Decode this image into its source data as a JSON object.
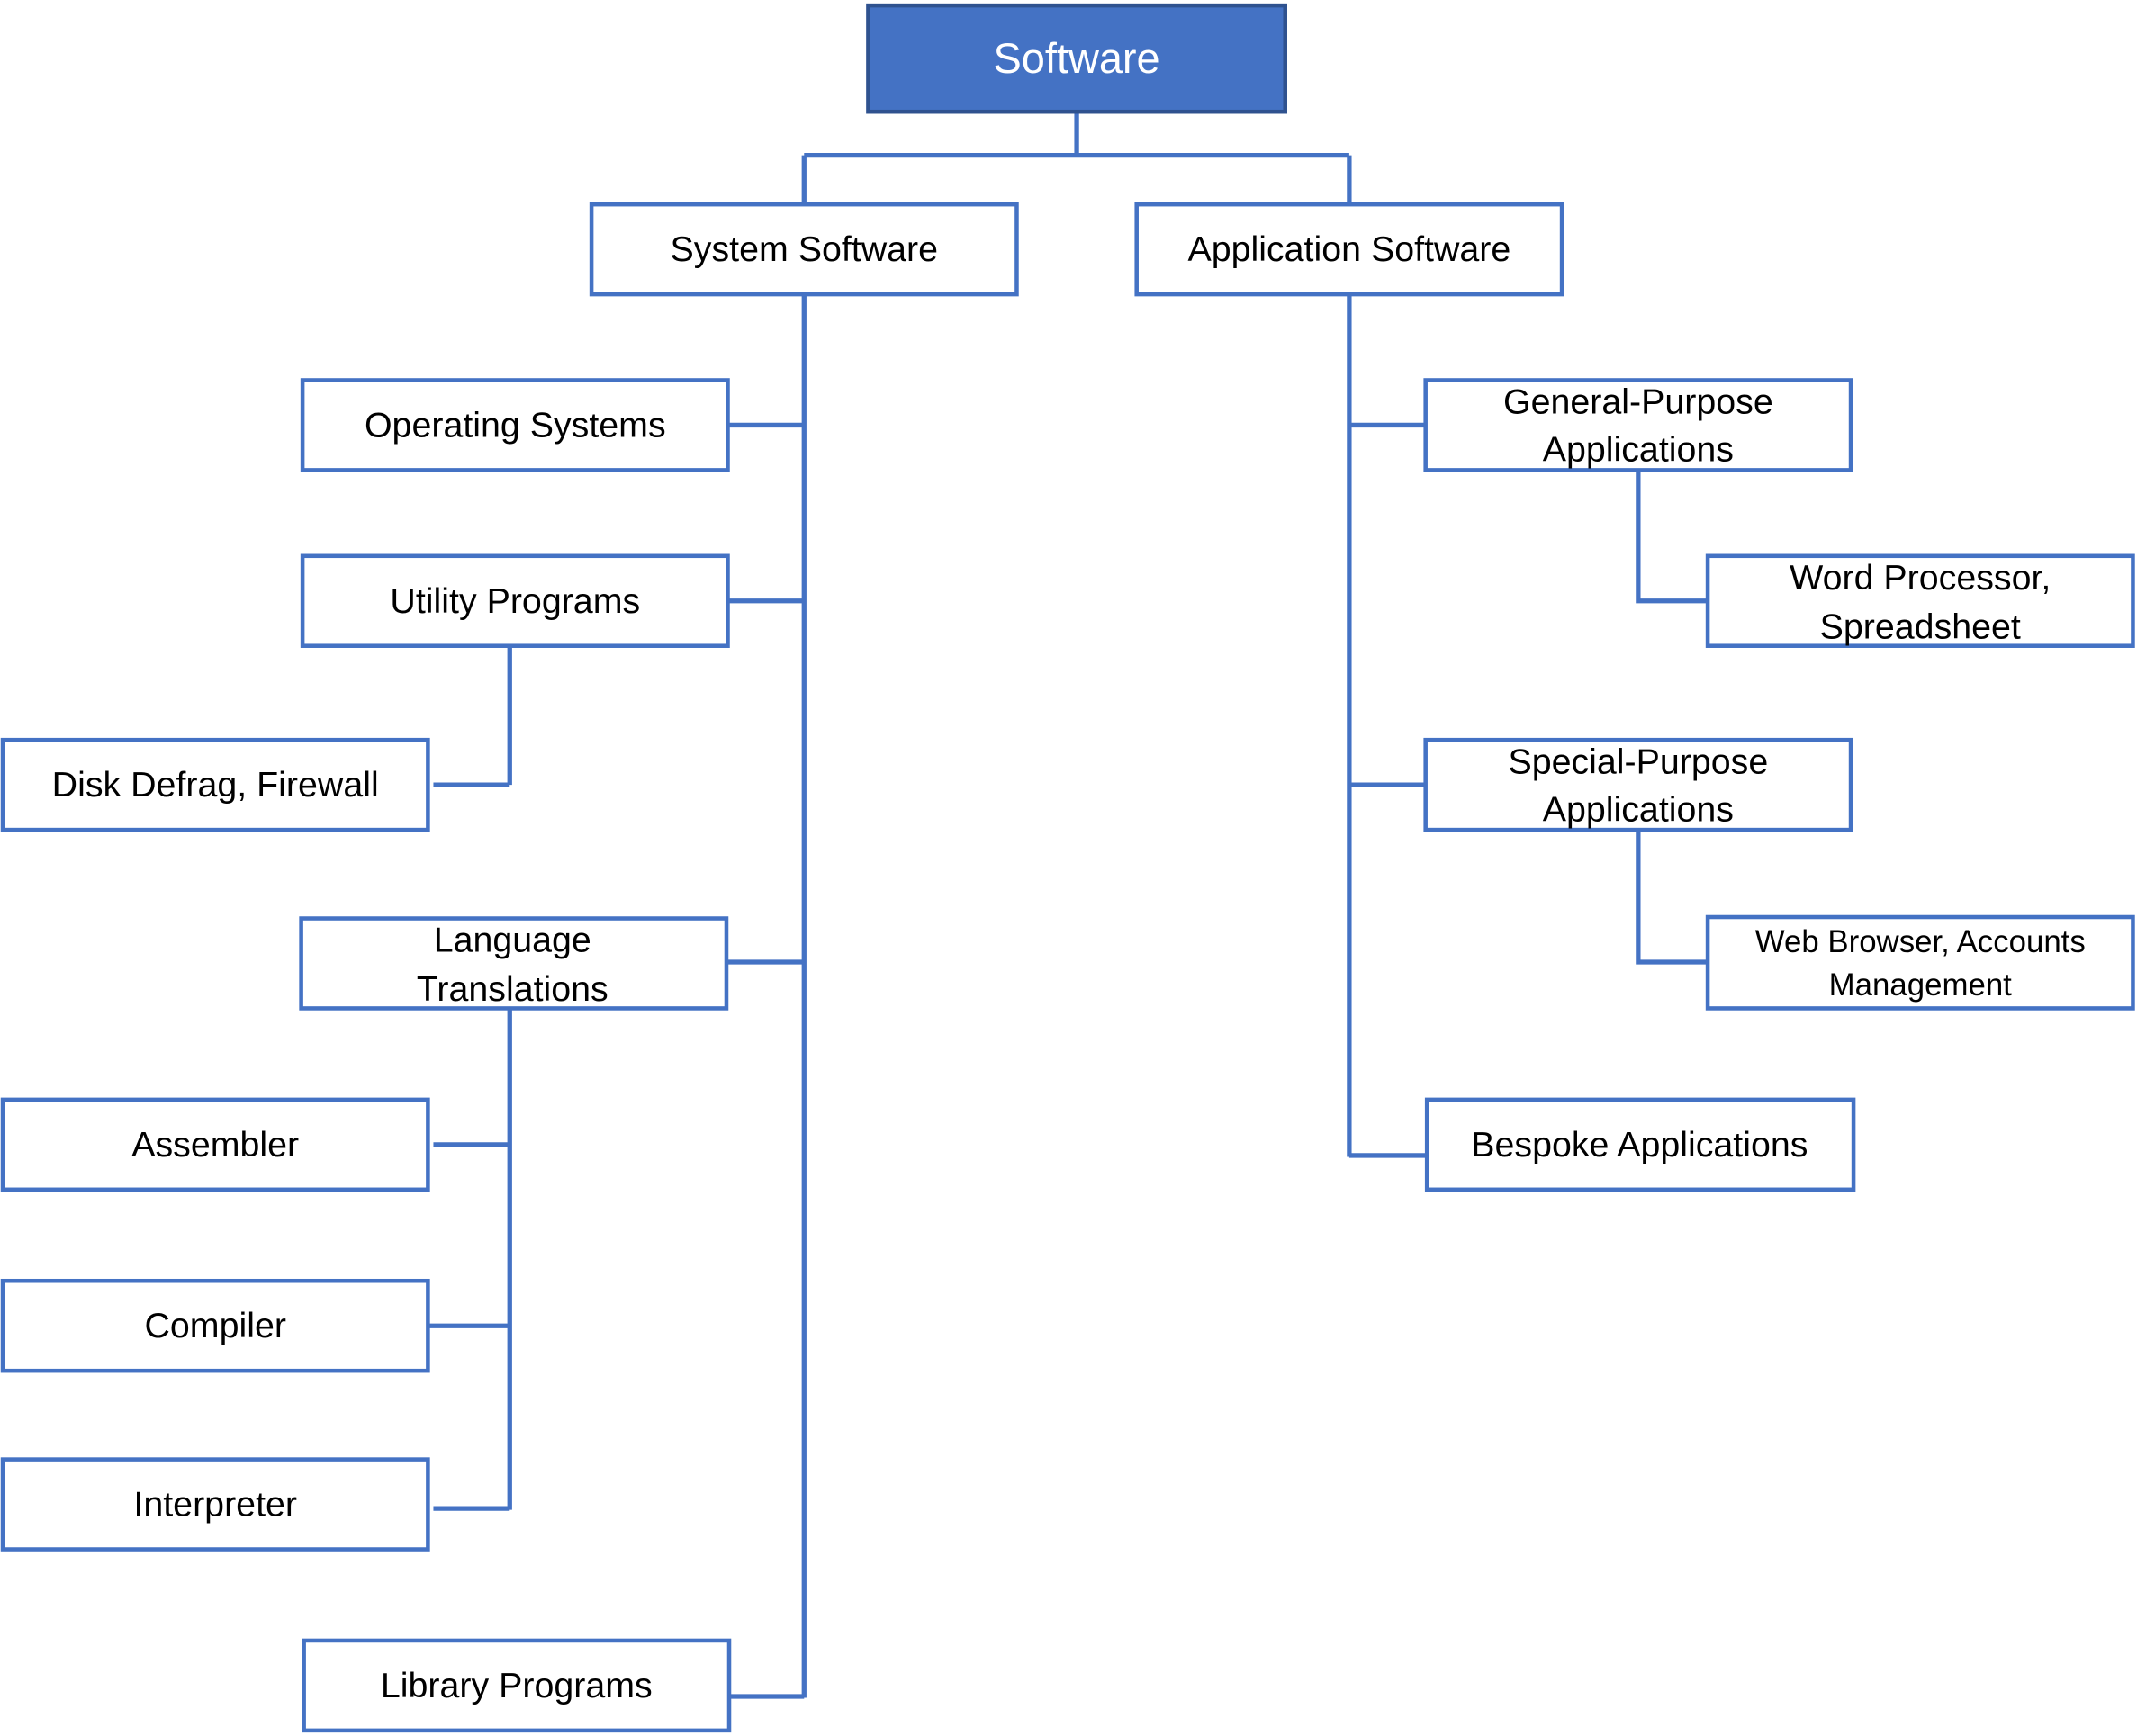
{
  "colors": {
    "accent": "#4472C4",
    "root_border": "#2F528F",
    "root_text": "#FFFFFF"
  },
  "root": {
    "label": "Software"
  },
  "system": {
    "label": "System Software",
    "children": [
      {
        "label": "Operating Systems"
      },
      {
        "label": "Utility Programs",
        "children": [
          {
            "label": "Disk Defrag, Firewall"
          }
        ]
      },
      {
        "label_lines": [
          "Language",
          "Translations"
        ],
        "children": [
          {
            "label": "Assembler"
          },
          {
            "label": "Compiler"
          },
          {
            "label": "Interpreter"
          }
        ]
      },
      {
        "label": "Library Programs"
      }
    ]
  },
  "application": {
    "label": "Application Software",
    "children": [
      {
        "label_lines": [
          "General-Purpose",
          "Applications"
        ],
        "children": [
          {
            "label_lines": [
              "Word Processor,",
              "Spreadsheet"
            ]
          }
        ]
      },
      {
        "label_lines": [
          "Special-Purpose",
          "Applications"
        ],
        "children": [
          {
            "label_lines": [
              "Web Browser, Accounts",
              "Management"
            ]
          }
        ]
      },
      {
        "label": "Bespoke Applications"
      }
    ]
  }
}
